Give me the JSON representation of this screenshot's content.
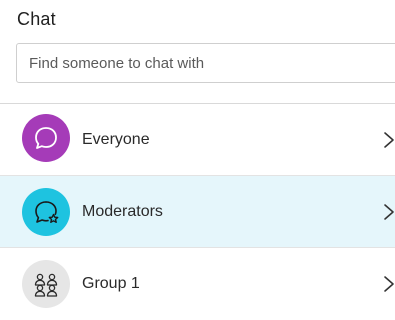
{
  "panel": {
    "title": "Chat"
  },
  "search": {
    "placeholder": "Find someone to chat with",
    "value": ""
  },
  "rows": [
    {
      "label": "Everyone",
      "icon": "chat-bubble-icon",
      "avatar_color": "#a53bb8",
      "selected": false
    },
    {
      "label": "Moderators",
      "icon": "chat-star-icon",
      "avatar_color": "#1ec3e0",
      "selected": true
    },
    {
      "label": "Group 1",
      "icon": "group-icon",
      "avatar_color": "#e6e6e6",
      "selected": false
    }
  ]
}
